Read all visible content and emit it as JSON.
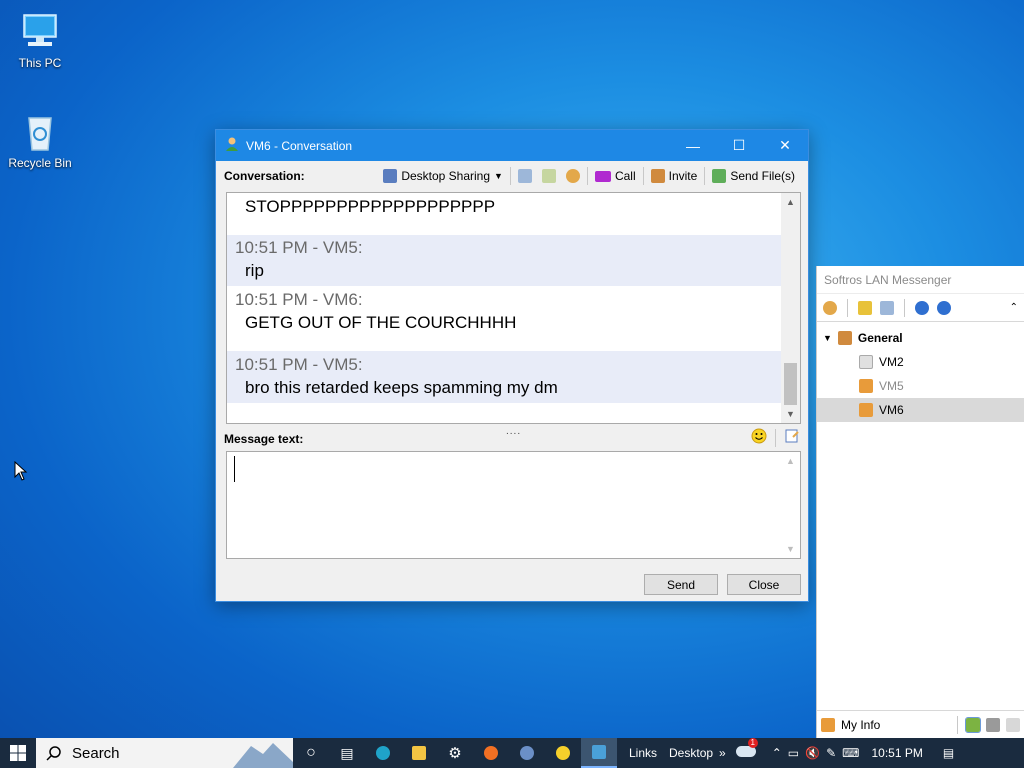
{
  "desktop": {
    "icons": [
      {
        "label": "This PC"
      },
      {
        "label": "Recycle Bin"
      }
    ]
  },
  "conversation_window": {
    "title": "VM6 - Conversation",
    "toolbar": {
      "conversation_label": "Conversation:",
      "desktop_sharing": "Desktop Sharing",
      "call": "Call",
      "invite": "Invite",
      "send_files": "Send File(s)"
    },
    "messages": [
      {
        "header": "",
        "text": "STOPPPPPPPPPPPPPPPPPPP"
      },
      {
        "header": "10:51 PM - VM5:",
        "text": "rip"
      },
      {
        "header": "10:51 PM - VM6:",
        "text": "GETG OUT OF THE COURCHHHH"
      },
      {
        "header": "10:51 PM - VM5:",
        "text": "bro this retarded keeps spamming my dm"
      }
    ],
    "message_text_label": "Message text:",
    "message_value": "",
    "send_label": "Send",
    "close_label": "Close"
  },
  "messenger": {
    "title": "Softros LAN Messenger",
    "group": "General",
    "users": [
      {
        "name": "VM2",
        "status": "offline"
      },
      {
        "name": "VM5",
        "status": "online"
      },
      {
        "name": "VM6",
        "status": "online"
      }
    ],
    "my_info": "My Info"
  },
  "taskbar": {
    "search_placeholder": "Search",
    "links": "Links",
    "desktop": "Desktop",
    "notification_count": "1",
    "clock": "10:51 PM"
  },
  "colors": {
    "titlebar": "#1e88e5",
    "taskbar": "#1a2b3f",
    "shaded_message": "#e8ecf8"
  }
}
